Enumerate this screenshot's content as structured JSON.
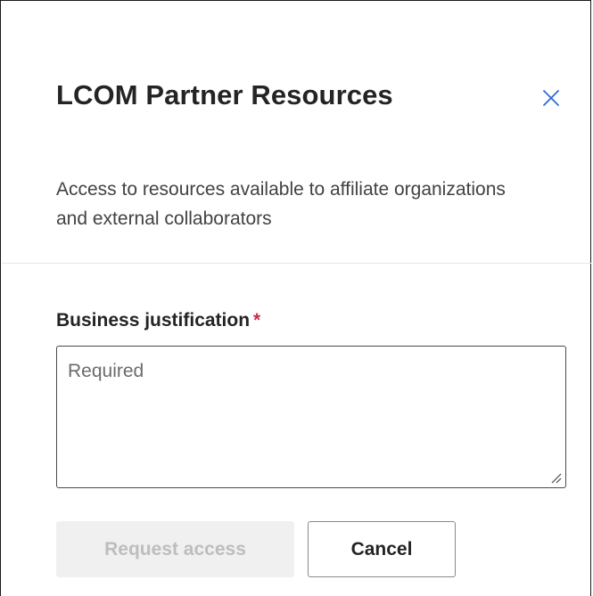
{
  "dialog": {
    "title": "LCOM Partner Resources",
    "description": "Access to resources available to affiliate organizations and external collaborators",
    "close_icon": "close-icon"
  },
  "form": {
    "justification_label": "Business justification",
    "required_marker": "*",
    "justification_placeholder": "Required",
    "justification_value": ""
  },
  "actions": {
    "request_label": "Request access",
    "request_disabled": true,
    "cancel_label": "Cancel"
  },
  "colors": {
    "required_marker": "#c4314b",
    "disabled_bg": "#f0f0f0",
    "disabled_text": "#bdbdbd"
  }
}
